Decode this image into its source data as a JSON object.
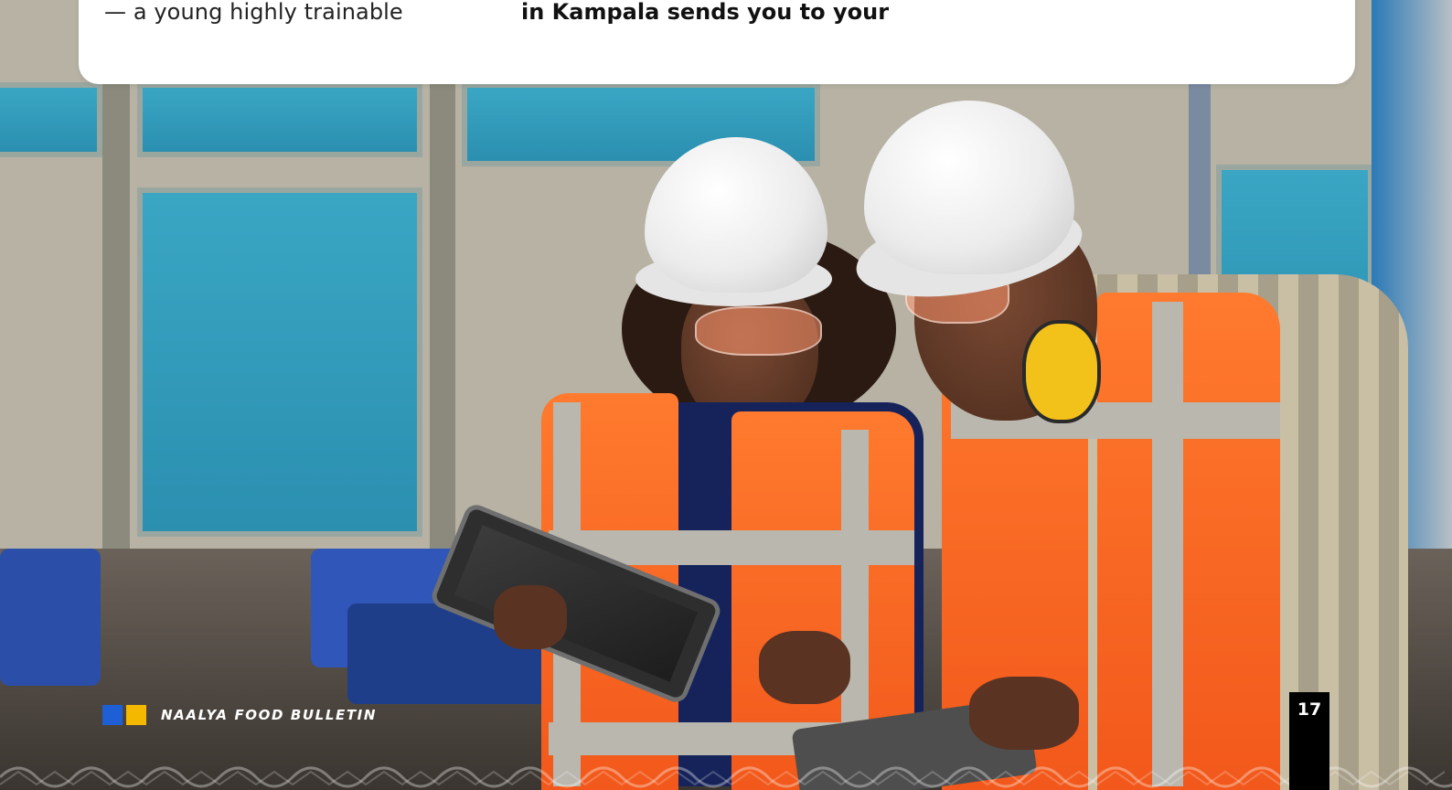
{
  "article": {
    "text_left": "— a young highly trainable",
    "text_right": "in Kampala sends you to your"
  },
  "footer": {
    "publication": "NAALYA FOOD BULLETIN",
    "page_number": "17"
  },
  "colors": {
    "brand_blue": "#1f5fd6",
    "brand_gold": "#f5b800",
    "page_tab": "#000000"
  },
  "photo": {
    "icon": "photo-icon"
  }
}
